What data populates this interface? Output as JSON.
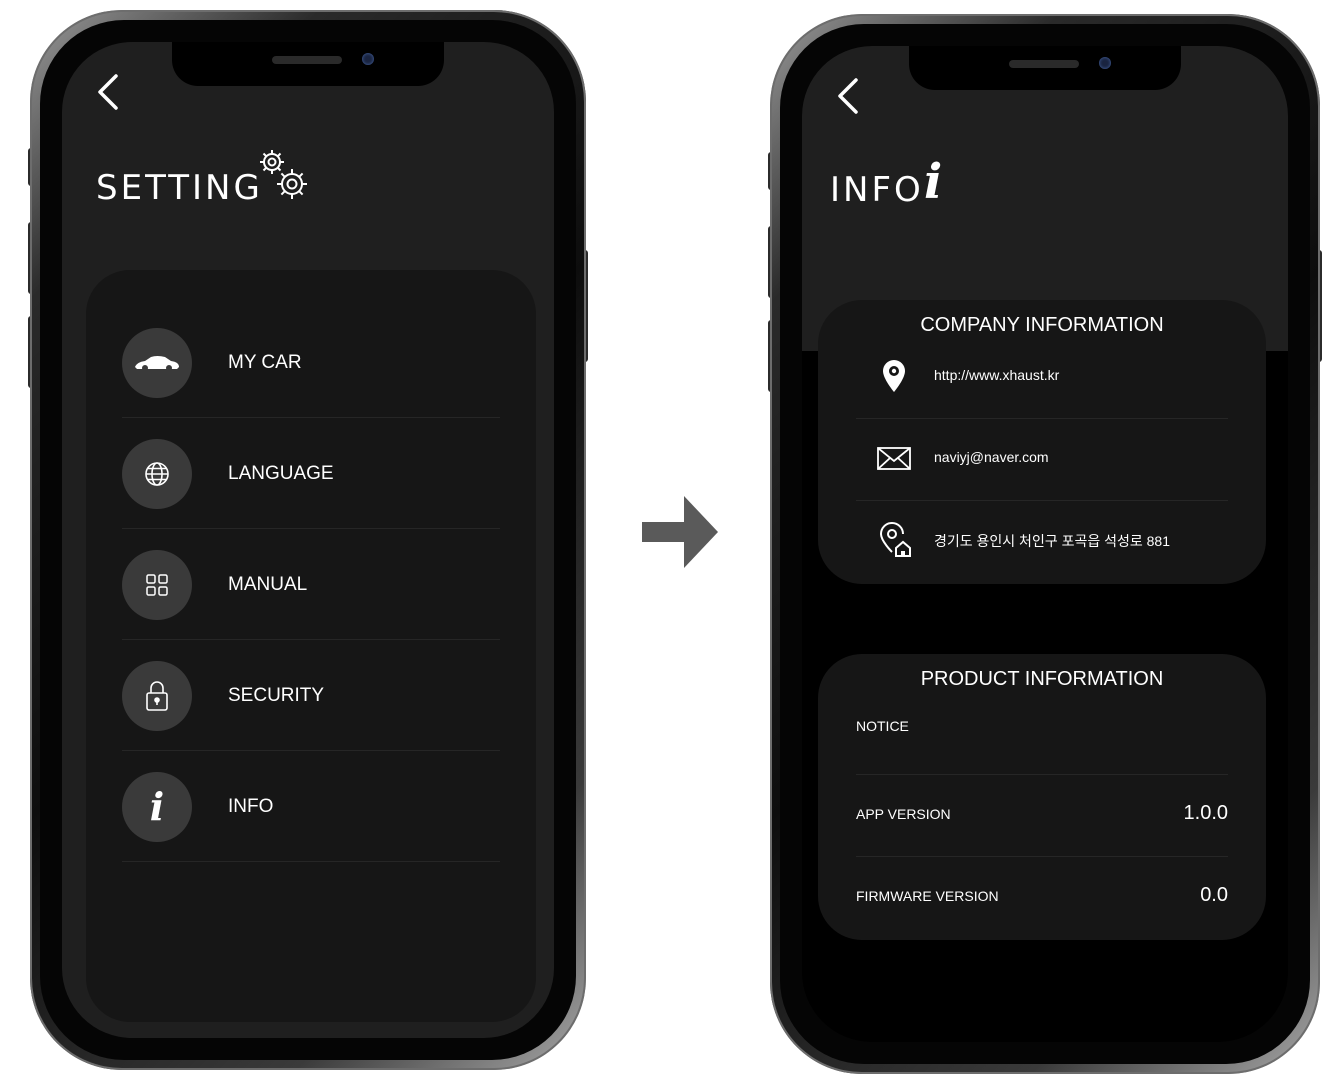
{
  "setting_screen": {
    "title": "SETTING",
    "menu": [
      {
        "label": "MY CAR",
        "icon": "car-icon"
      },
      {
        "label": "LANGUAGE",
        "icon": "globe-icon"
      },
      {
        "label": "MANUAL",
        "icon": "grid-icon"
      },
      {
        "label": "SECURITY",
        "icon": "lock-icon"
      },
      {
        "label": "INFO",
        "icon": "info-icon"
      }
    ]
  },
  "info_screen": {
    "title": "INFO",
    "company": {
      "heading": "COMPANY INFORMATION",
      "website": "http://www.xhaust.kr",
      "email": "naviyj@naver.com",
      "address": "경기도 용인시 처인구 포곡읍 석성로 881"
    },
    "product": {
      "heading": "PRODUCT INFORMATION",
      "notice_label": "NOTICE",
      "app_version_label": "APP VERSION",
      "app_version": "1.0.0",
      "firmware_label": "FIRMWARE VERSION",
      "firmware_version": "0.0"
    }
  },
  "colors": {
    "screen_bg": "#000000",
    "header_bg": "#1f1f1f",
    "card_bg": "#161616",
    "icon_circle": "#3a3a3a",
    "arrow": "#5a5a5a"
  }
}
